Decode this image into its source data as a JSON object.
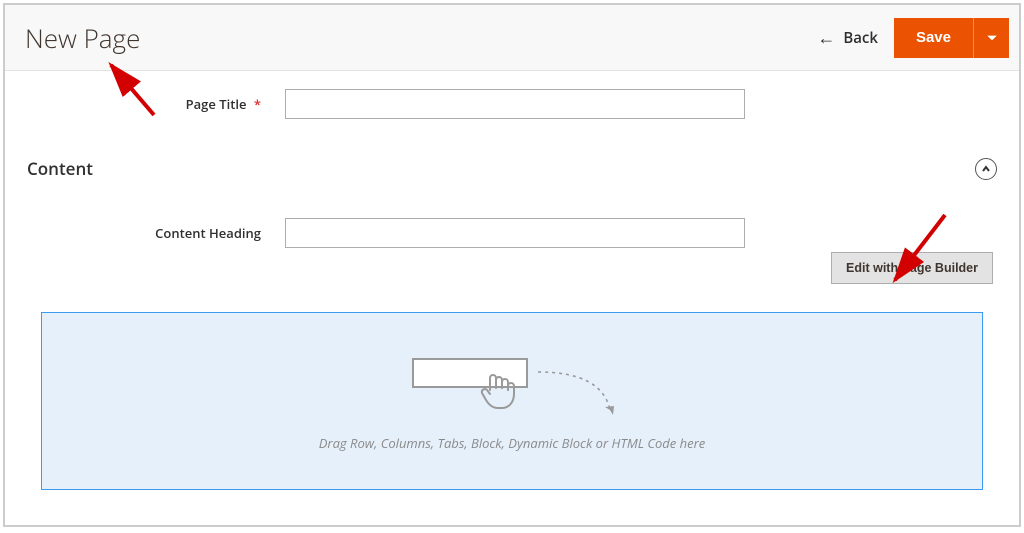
{
  "header": {
    "title": "New Page",
    "back_label": "Back",
    "save_label": "Save"
  },
  "form": {
    "page_title_label": "Page Title"
  },
  "content_section": {
    "title": "Content",
    "content_heading_label": "Content Heading",
    "edit_with_pb_label": "Edit with Page Builder",
    "dropzone_text": "Drag Row, Columns, Tabs, Block, Dynamic Block or HTML Code here"
  },
  "colors": {
    "accent": "#eb5202",
    "dropzone_border": "#3a9bf0",
    "dropzone_bg": "#e6f0fb",
    "arrow": "#d20000"
  }
}
